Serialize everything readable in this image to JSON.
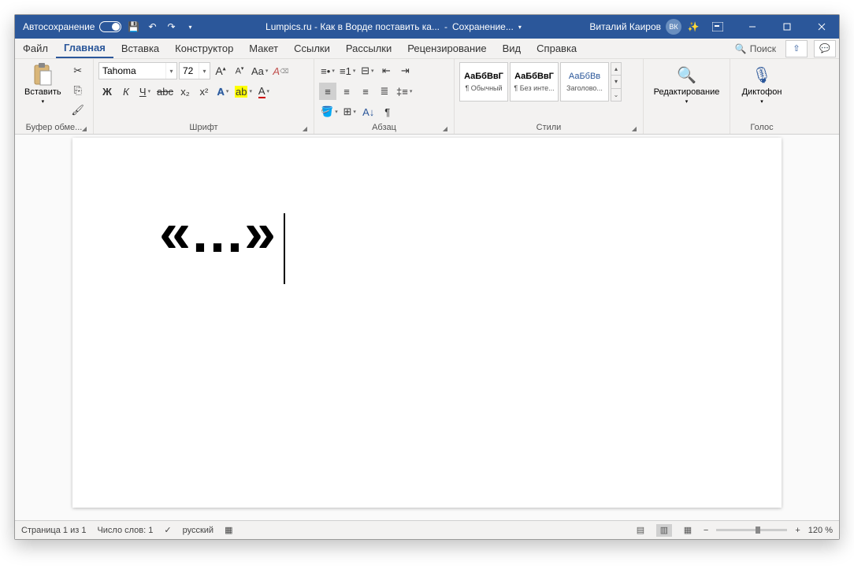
{
  "titlebar": {
    "autosave": "Автосохранение",
    "doc_title": "Lumpics.ru - Как в Ворде поставить ка...",
    "save_state": "Сохранение...",
    "user_name": "Виталий Каиров",
    "user_initials": "ВК"
  },
  "tabs": [
    "Файл",
    "Главная",
    "Вставка",
    "Конструктор",
    "Макет",
    "Ссылки",
    "Рассылки",
    "Рецензирование",
    "Вид",
    "Справка"
  ],
  "active_tab": 1,
  "search_placeholder": "Поиск",
  "ribbon": {
    "clipboard": {
      "label": "Буфер обме...",
      "paste": "Вставить"
    },
    "font": {
      "label": "Шрифт",
      "name": "Tahoma",
      "size": "72",
      "bold": "Ж",
      "italic": "К",
      "underline": "Ч",
      "strike": "abc",
      "sub": "x₂",
      "sup": "x²",
      "caseAa": "Aa",
      "grow": "A",
      "shrink": "A",
      "clear": "A"
    },
    "paragraph": {
      "label": "Абзац"
    },
    "styles": {
      "label": "Стили",
      "items": [
        {
          "preview": "АаБбВвГ",
          "name": "¶ Обычный"
        },
        {
          "preview": "АаБбВвГ",
          "name": "¶ Без инте..."
        },
        {
          "preview": "АаБбВв",
          "name": "Заголово..."
        }
      ]
    },
    "editing": {
      "label": "Редактирование"
    },
    "voice": {
      "label": "Голос",
      "dictate": "Диктофон"
    }
  },
  "document": {
    "text": "«...»"
  },
  "statusbar": {
    "page": "Страница 1 из 1",
    "words": "Число слов: 1",
    "lang": "русский",
    "zoom": "120 %"
  }
}
